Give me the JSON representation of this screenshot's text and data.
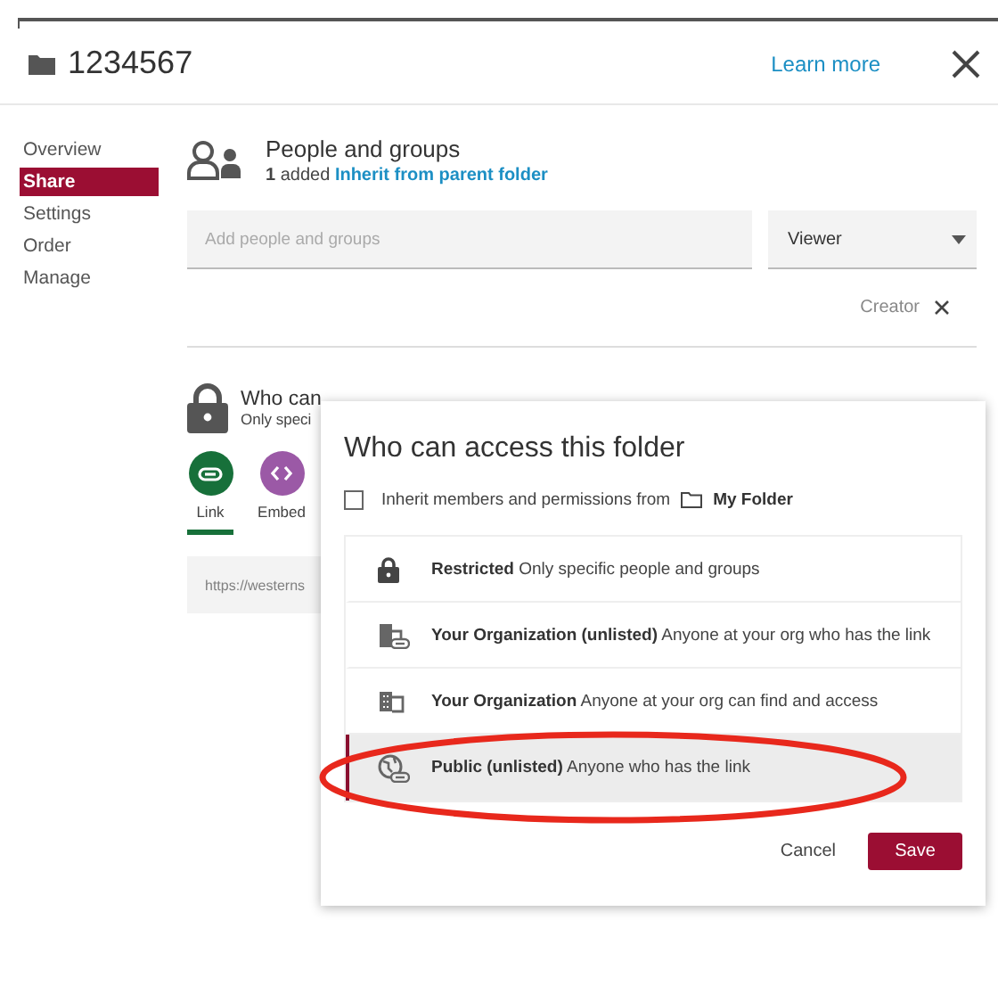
{
  "header": {
    "title": "1234567",
    "learn_more": "Learn more"
  },
  "sidebar": {
    "items": [
      {
        "label": "Overview",
        "selected": false
      },
      {
        "label": "Share",
        "selected": true
      },
      {
        "label": "Settings",
        "selected": false
      },
      {
        "label": "Order",
        "selected": false
      },
      {
        "label": "Manage",
        "selected": false
      }
    ]
  },
  "people": {
    "title": "People and groups",
    "count": "1",
    "added": "added",
    "inherit_link": "Inherit from parent folder",
    "placeholder": "Add people and groups",
    "role": "Viewer",
    "creator": "Creator"
  },
  "access": {
    "title": "Who can",
    "subtitle": "Only speci",
    "share_types": [
      {
        "kind": "link",
        "label": "Link",
        "selected": true
      },
      {
        "kind": "embed",
        "label": "Embed",
        "selected": false
      }
    ],
    "url": "https://westerns"
  },
  "dialog": {
    "title": "Who can access this folder",
    "inherit_label": "Inherit members and permissions from",
    "inherit_folder": "My Folder",
    "inherit_checked": false,
    "options": [
      {
        "kind": "lock",
        "name": "Restricted",
        "description": "Only specific people and groups",
        "selected": false
      },
      {
        "kind": "org-link",
        "name": "Your Organization (unlisted)",
        "description": "Anyone at your org who has the link",
        "selected": false
      },
      {
        "kind": "org",
        "name": "Your Organization",
        "description": "Anyone at your org can find and access",
        "selected": false
      },
      {
        "kind": "globe-link",
        "name": "Public (unlisted)",
        "description": "Anyone who has the link",
        "selected": true
      }
    ],
    "cancel": "Cancel",
    "save": "Save"
  }
}
